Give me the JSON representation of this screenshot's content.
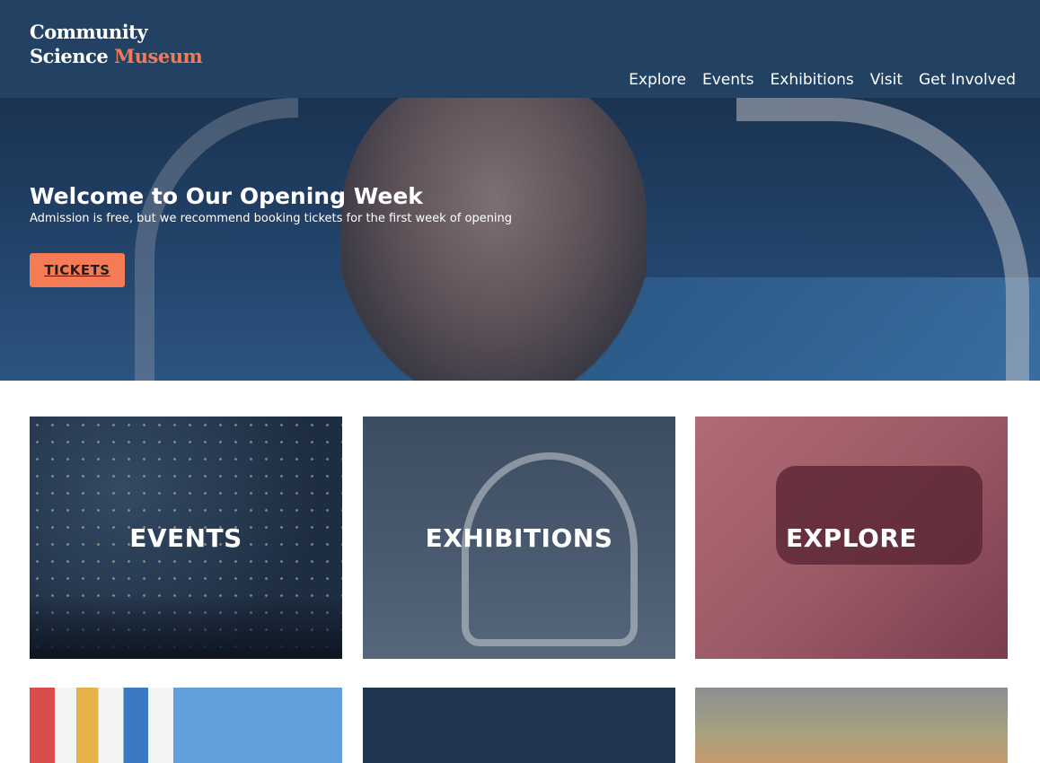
{
  "header": {
    "logo_line1": "Community",
    "logo_line2_plain": "Science",
    "logo_line2_accent": "Museum",
    "nav": [
      "Explore",
      "Events",
      "Exhibitions",
      "Visit",
      "Get Involved"
    ]
  },
  "hero": {
    "title": "Welcome to Our Opening Week",
    "subtitle": "Admission is free, but we recommend booking tickets for the first week of opening",
    "cta": "TICKETS"
  },
  "cards": [
    {
      "label": "EVENTS"
    },
    {
      "label": "EXHIBITIONS"
    },
    {
      "label": "EXPLORE"
    }
  ],
  "colors": {
    "header_bg": "#234263",
    "accent": "#f07b58",
    "button": "#f47b55"
  }
}
